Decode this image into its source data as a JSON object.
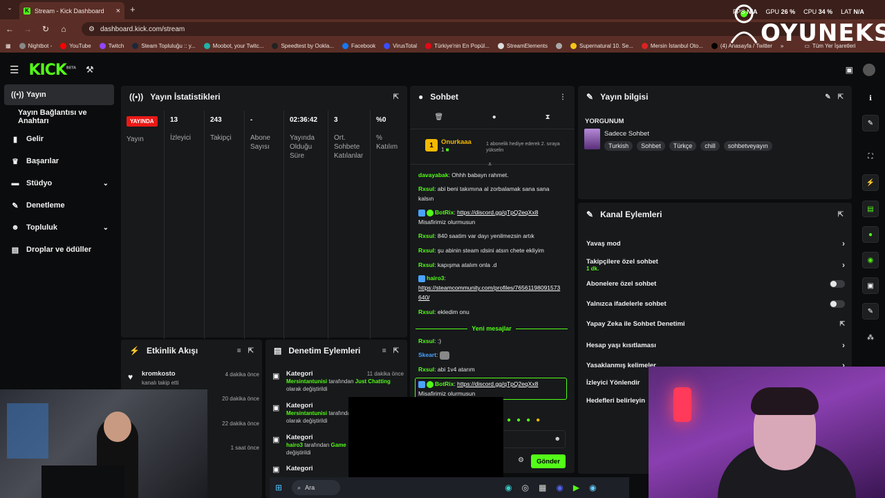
{
  "browser": {
    "tab_title": "Stream - Kick Dashboard",
    "url": "dashboard.kick.com/stream",
    "bookmarks": [
      "Nightbot -",
      "YouTube",
      "Twitch",
      "Steam Topluluğu :: y...",
      "Moobot, your Twitc...",
      "Speedtest by Ookla...",
      "Facebook",
      "VirusTotal",
      "Türkiye'nin En Popül...",
      "StreamElements",
      "Supernatural 10. Se...",
      "Mersin İstanbul Oto...",
      "(4) Anasayfa / Twitter"
    ],
    "all_bookmarks": "Tüm Yer İşaretleri"
  },
  "overlay": {
    "fps_label": "FPS",
    "fps_value": "N/A",
    "gpu_label": "GPU",
    "gpu_value": "26 %",
    "cpu_label": "CPU",
    "cpu_value": "34 %",
    "lat_label": "LAT",
    "lat_value": "N/A",
    "brand": "OYUNEKS"
  },
  "kick": {
    "logo": "KICK",
    "beta": "BETA"
  },
  "sidebar": {
    "items": [
      {
        "label": "Yayın",
        "icon": "broadcast-icon"
      },
      {
        "label": "Yayın Bağlantısı ve Anahtarı",
        "icon": ""
      },
      {
        "label": "Gelir",
        "icon": "chart-icon"
      },
      {
        "label": "Başarılar",
        "icon": "trophy-icon"
      },
      {
        "label": "Stüdyo",
        "icon": "studio-icon"
      },
      {
        "label": "Denetleme",
        "icon": "wrench-icon"
      },
      {
        "label": "Topluluk",
        "icon": "users-icon"
      },
      {
        "label": "Droplar ve ödüller",
        "icon": "gift-icon"
      }
    ]
  },
  "stats": {
    "title": "Yayın İstatistikleri",
    "live": "YAYINDA",
    "live_label": "Yayın",
    "columns": [
      {
        "value": "13",
        "label": "İzleyici"
      },
      {
        "value": "243",
        "label": "Takipçi"
      },
      {
        "value": "-",
        "label": "Abone Sayısı"
      },
      {
        "value": "02:36:42",
        "label": "Yayında Olduğu Süre"
      },
      {
        "value": "3",
        "label": "Ort. Sohbete Katılanlar"
      },
      {
        "value": "%0",
        "label": "% Katılım"
      }
    ]
  },
  "chat": {
    "title": "Sohbet",
    "gift_user": "Onurkaaa",
    "gift_rank": "1",
    "gift_text": "1 abonelik hediye ederek 2. sıraya yükselin",
    "new_messages": "Yeni mesajlar",
    "send": "Gönder",
    "messages": [
      {
        "user": "davayabak",
        "text": "Ohhh babayn rahmet."
      },
      {
        "user": "Rxsul",
        "text": "abi beni takımına al zorbalamak sana sana kalsın"
      },
      {
        "user": "BotRix",
        "text": "https://discord.gg/qTpQ2eqXx8",
        "extra": "Misafirimiz olurmusun"
      },
      {
        "user": "Rxsul",
        "text": "840 saatim var dayı yenilmezsin artık"
      },
      {
        "user": "Rxsul",
        "text": "şu abinin steam ıdsini atsın chete ekliyim"
      },
      {
        "user": "Rxsul",
        "text": "kapışma atalım onla .d"
      },
      {
        "user": "hairo3",
        "text": "https://steamcommunity.com/profiles/76561198091573640/"
      },
      {
        "user": "Rxsul",
        "text": "ekledim onu"
      },
      {
        "user": "Rxsul",
        "text": ":)"
      },
      {
        "user": "Skeart",
        "text": ""
      },
      {
        "user": "Rxsul",
        "text": "abi 1v4 atarım"
      },
      {
        "user": "BotRix",
        "text": "https://discord.gg/qTpQ2eqXx8",
        "extra": "Misafirimiz olurmusun"
      }
    ]
  },
  "info": {
    "title": "Yayın bilgisi",
    "stream_title": "YORGUNUM",
    "category": "Sadece Sohbet",
    "tags": [
      "Turkish",
      "Sohbet",
      "Türkçe",
      "chill",
      "sohbetveyayın"
    ]
  },
  "actions": {
    "title": "Kanal Eylemleri",
    "items": [
      {
        "label": "Yavaş mod",
        "kind": "chevron"
      },
      {
        "label": "Takipçilere özel sohbet",
        "sub": "1 dk.",
        "kind": "chevron"
      },
      {
        "label": "Abonelere özel sohbet",
        "kind": "toggle"
      },
      {
        "label": "Yalnızca ifadelerle sohbet",
        "kind": "toggle"
      },
      {
        "label": "Yapay Zeka ile Sohbet Denetimi",
        "kind": "external"
      },
      {
        "label": "Hesap yaşı kısıtlaması",
        "kind": "chevron"
      },
      {
        "label": "Yasaklanmış kelimeler",
        "kind": "chevron"
      },
      {
        "label": "İzleyici Yönlendir",
        "kind": "none"
      },
      {
        "label": "Hedefleri belirleyin",
        "kind": "none"
      }
    ]
  },
  "activity": {
    "title": "Etkinlik Akışı",
    "items": [
      {
        "user": "kromkosto",
        "text": "kanalı takip etti",
        "time": "4 dakika önce"
      },
      {
        "time": "20 dakika önce"
      },
      {
        "time": "22 dakika önce"
      },
      {
        "time": "1 saat önce"
      }
    ]
  },
  "moderation": {
    "title": "Denetim Eylemleri",
    "items": [
      {
        "title": "Kategori",
        "time": "11 dakika önce",
        "user": "Mersintantunisi",
        "mid": "tarafından",
        "target": "Just Chatting",
        "end": "olarak değiştirildi"
      },
      {
        "title": "Kategori",
        "time": "",
        "user": "Mersintantunisi",
        "mid": "tarafından",
        "target": "",
        "end": "olarak değiştirildi"
      },
      {
        "title": "Kategori",
        "time": "",
        "user": "hairo3",
        "mid": "tarafından",
        "target": "Game",
        "end": "değiştirildi"
      },
      {
        "title": "Kategori",
        "time": "",
        "user": "",
        "mid": "",
        "target": "",
        "end": ""
      }
    ]
  },
  "taskbar": {
    "search": "Ara"
  },
  "colors": {
    "accent": "#53fc18",
    "live": "#e91916",
    "panel": "#17191b",
    "bg": "#0b0c0d"
  }
}
